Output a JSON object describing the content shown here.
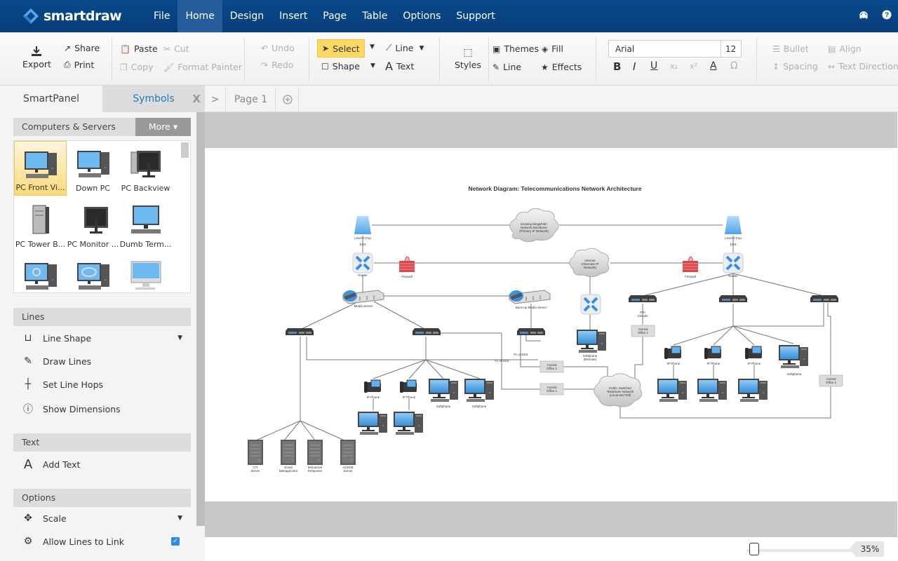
{
  "app": {
    "brand": "smartdraw"
  },
  "menu": {
    "items": [
      "File",
      "Home",
      "Design",
      "Insert",
      "Page",
      "Table",
      "Options",
      "Support"
    ],
    "active": "Home"
  },
  "top_icons": {
    "support": "headset-icon",
    "help": "help-icon"
  },
  "ribbon": {
    "export": "Export",
    "share": "Share",
    "print": "Print",
    "paste": "Paste",
    "cut": "Cut",
    "copy": "Copy",
    "format_painter": "Format Painter",
    "undo": "Undo",
    "redo": "Redo",
    "select": "Select",
    "line": "Line",
    "shape": "Shape",
    "text": "Text",
    "styles": "Styles",
    "themes": "Themes",
    "fill": "Fill",
    "line2": "Line",
    "effects": "Effects",
    "font_name": "Arial",
    "font_size": "12",
    "bold": "B",
    "italic": "I",
    "underline": "U",
    "subscript": "x₂",
    "superscript": "x²",
    "font_color": "A",
    "symbol": "Ω",
    "bullet": "Bullet",
    "align": "Align",
    "spacing": "Spacing",
    "text_direction": "Text Direction"
  },
  "panel": {
    "tabs": {
      "smartpanel": "SmartPanel",
      "symbols": "Symbols",
      "close": "X"
    },
    "library": {
      "name": "Computers & Servers",
      "more": "More"
    },
    "symbols": [
      "PC Front Vi...",
      "Down PC",
      "PC Backview",
      "PC Tower B...",
      "PC Monitor ...",
      "Dumb Term...",
      "",
      "",
      ""
    ],
    "lines": {
      "title": "Lines",
      "items": [
        "Line Shape",
        "Draw Lines",
        "Set Line Hops",
        "Show Dimensions"
      ]
    },
    "text": {
      "title": "Text",
      "items": [
        "Add Text"
      ]
    },
    "options": {
      "title": "Options",
      "items": [
        "Scale",
        "Allow Lines to Link"
      ],
      "allow_lines_checked": true
    }
  },
  "pages": {
    "expand": ">",
    "current": "Page 1",
    "add": "+"
  },
  "diagram": {
    "title": "Network Diagram: Telecommunications Network Architecture",
    "labels": {
      "pop_left": "Level 3 Pop",
      "ds3_left": "DS3",
      "pop_right": "Level 3 Pop",
      "ds3_right": "DS3",
      "router_left": "Router",
      "router_right": "Router",
      "firewall_left": "Firewall",
      "firewall_right": "Firewall",
      "backbone": [
        "Existing MegaPath",
        "Network Backbone",
        "(Primary IP Network)"
      ],
      "internet": [
        "Internet",
        "(Alternate IP",
        "Network)"
      ],
      "pstn": [
        "Public Switched",
        "Telephone Network",
        "(Local and Toll)"
      ],
      "media_server": "Media Server",
      "backup_media_server": "Back-up Media Server",
      "pri": [
        "PRI",
        "Circuits"
      ],
      "co1": [
        "Central",
        "Office 1"
      ],
      "co2": [
        "Central",
        "Office 2"
      ],
      "t1_a": "T1 or DS3",
      "t1_b": "T1 or DS3",
      "ip_phone": "IP Phone",
      "softphone": "Softphone",
      "softphone_remote": [
        "Softphone",
        "(Remote)"
      ],
      "servers": [
        [
          "CTI",
          "Server"
        ],
        [
          "Email",
          "Management"
        ],
        [
          "Interactive",
          "Response"
        ],
        [
          "ACD/IB",
          "Server"
        ]
      ]
    }
  },
  "zoom": {
    "value": "35%",
    "fraction": 0.35
  }
}
